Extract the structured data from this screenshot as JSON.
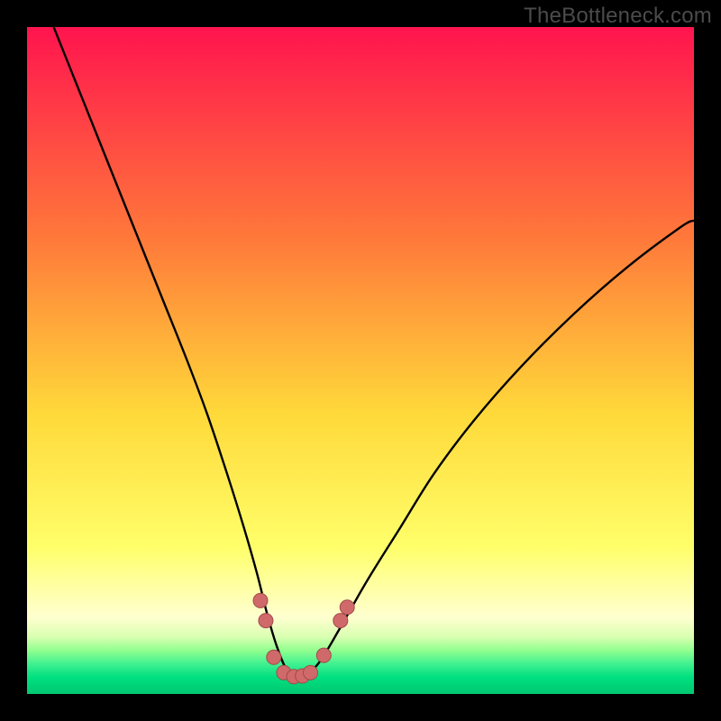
{
  "watermark": "TheBottleneck.com",
  "colors": {
    "bg_black": "#000000",
    "curve": "#000000",
    "dot_fill": "#d06a6a",
    "dot_stroke": "#a34a4a",
    "grad_top": "#ff144e",
    "grad_mid1": "#ff7a3a",
    "grad_mid2": "#ffd93a",
    "grad_yellow": "#ffff6a",
    "grad_lightyellow": "#ffffd0",
    "grad_green1": "#6fff6f",
    "grad_green2": "#00e878",
    "grad_green3": "#00c870"
  },
  "chart_data": {
    "type": "line",
    "title": "",
    "xlabel": "",
    "ylabel": "",
    "xlim": [
      0,
      100
    ],
    "ylim": [
      0,
      100
    ],
    "series": [
      {
        "name": "bottleneck-curve",
        "x": [
          4,
          8,
          12,
          16,
          20,
          24,
          27,
          30,
          32.5,
          34.5,
          36,
          37.5,
          39,
          40.5,
          42,
          44,
          47,
          51,
          56,
          61,
          67,
          74,
          82,
          90,
          98,
          100
        ],
        "values": [
          100,
          90,
          80,
          70,
          60,
          50,
          42,
          33,
          25,
          18,
          12,
          7,
          3.5,
          2.5,
          3,
          5,
          10,
          17,
          25,
          33,
          41,
          49,
          57,
          64,
          70,
          71
        ]
      }
    ],
    "annotations": {
      "dots": [
        {
          "x": 35.0,
          "y": 14
        },
        {
          "x": 35.8,
          "y": 11
        },
        {
          "x": 37.0,
          "y": 5.5
        },
        {
          "x": 38.5,
          "y": 3.2
        },
        {
          "x": 40.0,
          "y": 2.6
        },
        {
          "x": 41.3,
          "y": 2.7
        },
        {
          "x": 42.5,
          "y": 3.2
        },
        {
          "x": 44.5,
          "y": 5.8
        },
        {
          "x": 47.0,
          "y": 11
        },
        {
          "x": 48.0,
          "y": 13
        }
      ]
    },
    "gradient_stops": [
      {
        "pos": 0.0,
        "color": "#ff144e"
      },
      {
        "pos": 0.32,
        "color": "#ff7a3a"
      },
      {
        "pos": 0.58,
        "color": "#ffd93a"
      },
      {
        "pos": 0.78,
        "color": "#ffff6a"
      },
      {
        "pos": 0.885,
        "color": "#ffffd0"
      },
      {
        "pos": 0.915,
        "color": "#d8ffb0"
      },
      {
        "pos": 0.935,
        "color": "#8fff8f"
      },
      {
        "pos": 0.955,
        "color": "#40f090"
      },
      {
        "pos": 0.975,
        "color": "#00e080"
      },
      {
        "pos": 1.0,
        "color": "#00c870"
      }
    ]
  }
}
